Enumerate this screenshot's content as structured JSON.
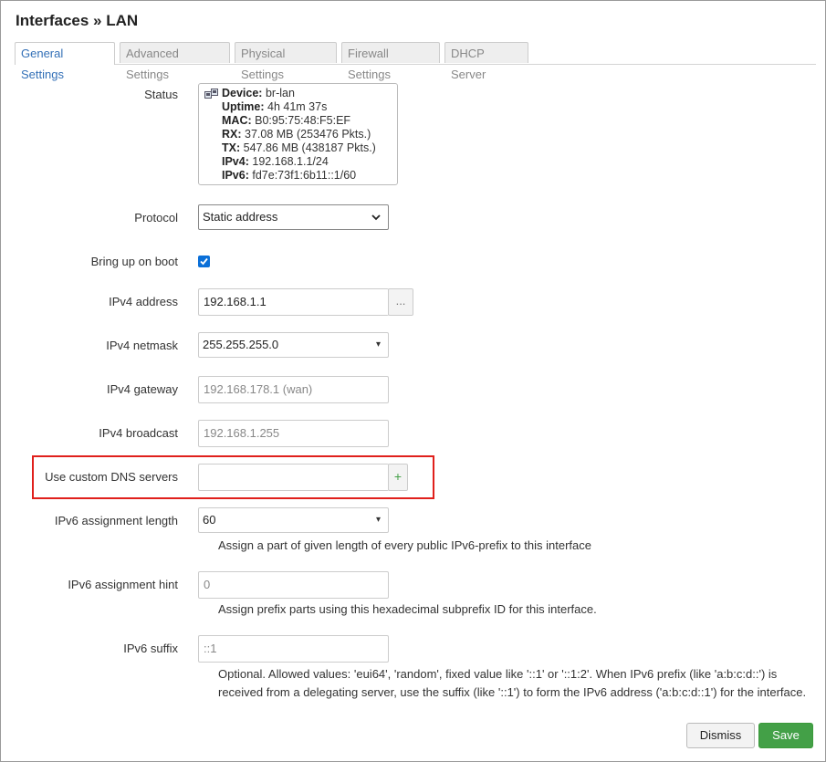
{
  "dialog": {
    "title": "Interfaces » LAN"
  },
  "tabs": [
    {
      "label": "General Settings",
      "active": true
    },
    {
      "label": "Advanced Settings",
      "active": false
    },
    {
      "label": "Physical Settings",
      "active": false
    },
    {
      "label": "Firewall Settings",
      "active": false
    },
    {
      "label": "DHCP Server",
      "active": false
    }
  ],
  "status": {
    "label": "Status",
    "icon": "ethernet-port-icon",
    "lines": [
      {
        "key": "Device:",
        "value": "br-lan"
      },
      {
        "key": "Uptime:",
        "value": "4h 41m 37s"
      },
      {
        "key": "MAC:",
        "value": "B0:95:75:48:F5:EF"
      },
      {
        "key": "RX:",
        "value": "37.08 MB (253476 Pkts.)"
      },
      {
        "key": "TX:",
        "value": "547.86 MB (438187 Pkts.)"
      },
      {
        "key": "IPv4:",
        "value": "192.168.1.1/24"
      },
      {
        "key": "IPv6:",
        "value": "fd7e:73f1:6b11::1/60"
      }
    ]
  },
  "protocol": {
    "label": "Protocol",
    "value": "Static address"
  },
  "boot": {
    "label": "Bring up on boot",
    "checked": true
  },
  "ipv4_address": {
    "label": "IPv4 address",
    "value": "192.168.1.1",
    "button": "..."
  },
  "ipv4_netmask": {
    "label": "IPv4 netmask",
    "value": "255.255.255.0"
  },
  "ipv4_gateway": {
    "label": "IPv4 gateway",
    "placeholder": "192.168.178.1 (wan)"
  },
  "ipv4_broadcast": {
    "label": "IPv4 broadcast",
    "placeholder": "192.168.1.255"
  },
  "dns": {
    "label": "Use custom DNS servers",
    "value": "",
    "add_button": "+"
  },
  "ipv6_length": {
    "label": "IPv6 assignment length",
    "value": "60",
    "help": "Assign a part of given length of every public IPv6-prefix to this interface"
  },
  "ipv6_hint": {
    "label": "IPv6 assignment hint",
    "placeholder": "0",
    "help": "Assign prefix parts using this hexadecimal subprefix ID for this interface."
  },
  "ipv6_suffix": {
    "label": "IPv6 suffix",
    "placeholder": "::1",
    "help_line1": "Optional. Allowed values: 'eui64', 'random', fixed value like '::1' or '::1:2'. When IPv6 prefix (like 'a:b:c:d::') is",
    "help_line2": "received from a delegating server, use the suffix (like '::1') to form the IPv6 address ('a:b:c:d::1') for the interface."
  },
  "footer": {
    "dismiss": "Dismiss",
    "save": "Save"
  },
  "colors": {
    "accent": "#3370b7",
    "save": "#43a047",
    "highlight": "#e0201c"
  }
}
